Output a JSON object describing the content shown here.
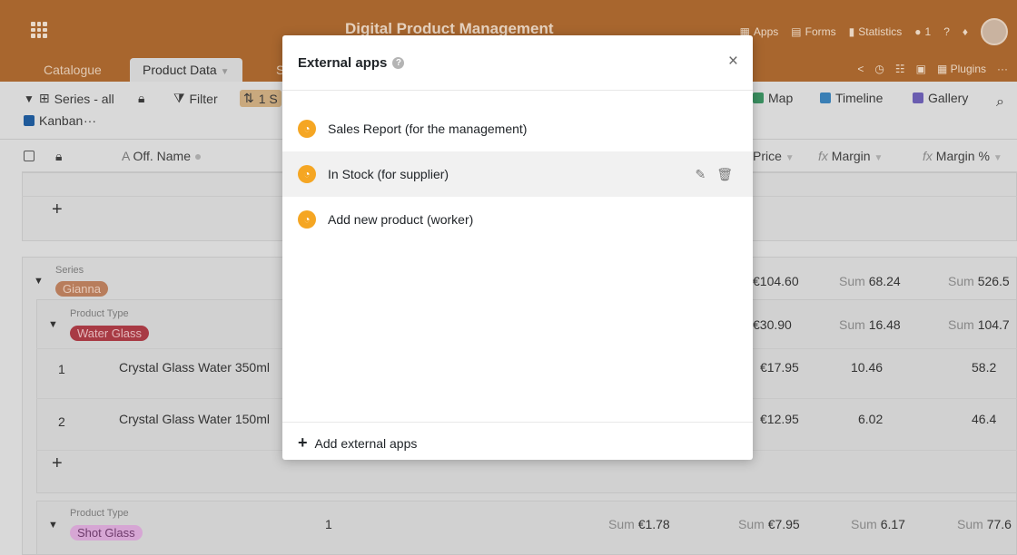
{
  "header": {
    "base_title": "Digital Product Management",
    "apps": "Apps",
    "forms": "Forms",
    "statistics": "Statistics",
    "collaborators": "1"
  },
  "tabs": [
    {
      "label": "Catalogue"
    },
    {
      "label": "Product Data"
    },
    {
      "label": "S"
    }
  ],
  "tabs_right": {
    "plugins": "Plugins"
  },
  "toolbar": {
    "view": "Series - all",
    "filter": "Filter",
    "sort": "1 S",
    "map": "Map",
    "timeline": "Timeline",
    "gallery": "Gallery",
    "kanban": "Kanban",
    "more": "···"
  },
  "columns": {
    "off_name": "Off. Name",
    "price": "Price",
    "margin": "Margin",
    "margin_pct": "Margin %"
  },
  "groups": {
    "series_label": "Series",
    "series_value": "Gianna",
    "series_price": "€104.60",
    "series_margin_sum_label": "Sum",
    "series_margin_sum": "68.24",
    "series_margin_pct_sum": "526.5",
    "pt_label": "Product Type",
    "pt1_value": "Water Glass",
    "pt1_price": "€30.90",
    "pt1_margin": "16.48",
    "pt1_margin_pct": "104.7",
    "pt2_value": "Shot Glass",
    "pt2_count": "1",
    "pt2_sum1": "€1.78",
    "pt2_sum2": "€7.95",
    "pt2_sum3": "6.17",
    "pt2_sum4": "77.6"
  },
  "rows": [
    {
      "num": "1",
      "name": "Crystal Glass Water 350ml",
      "price": "€17.95",
      "margin": "10.46",
      "margin_pct": "58.2"
    },
    {
      "num": "2",
      "name": "Crystal Glass Water 150ml",
      "price": "€12.95",
      "margin": "6.02",
      "margin_pct": "46.4"
    }
  ],
  "modal": {
    "title": "External apps",
    "items": [
      {
        "label": "Sales Report (for the management)"
      },
      {
        "label": "In Stock (for supplier)"
      },
      {
        "label": "Add new product (worker)"
      }
    ],
    "add_label": "Add external apps"
  }
}
